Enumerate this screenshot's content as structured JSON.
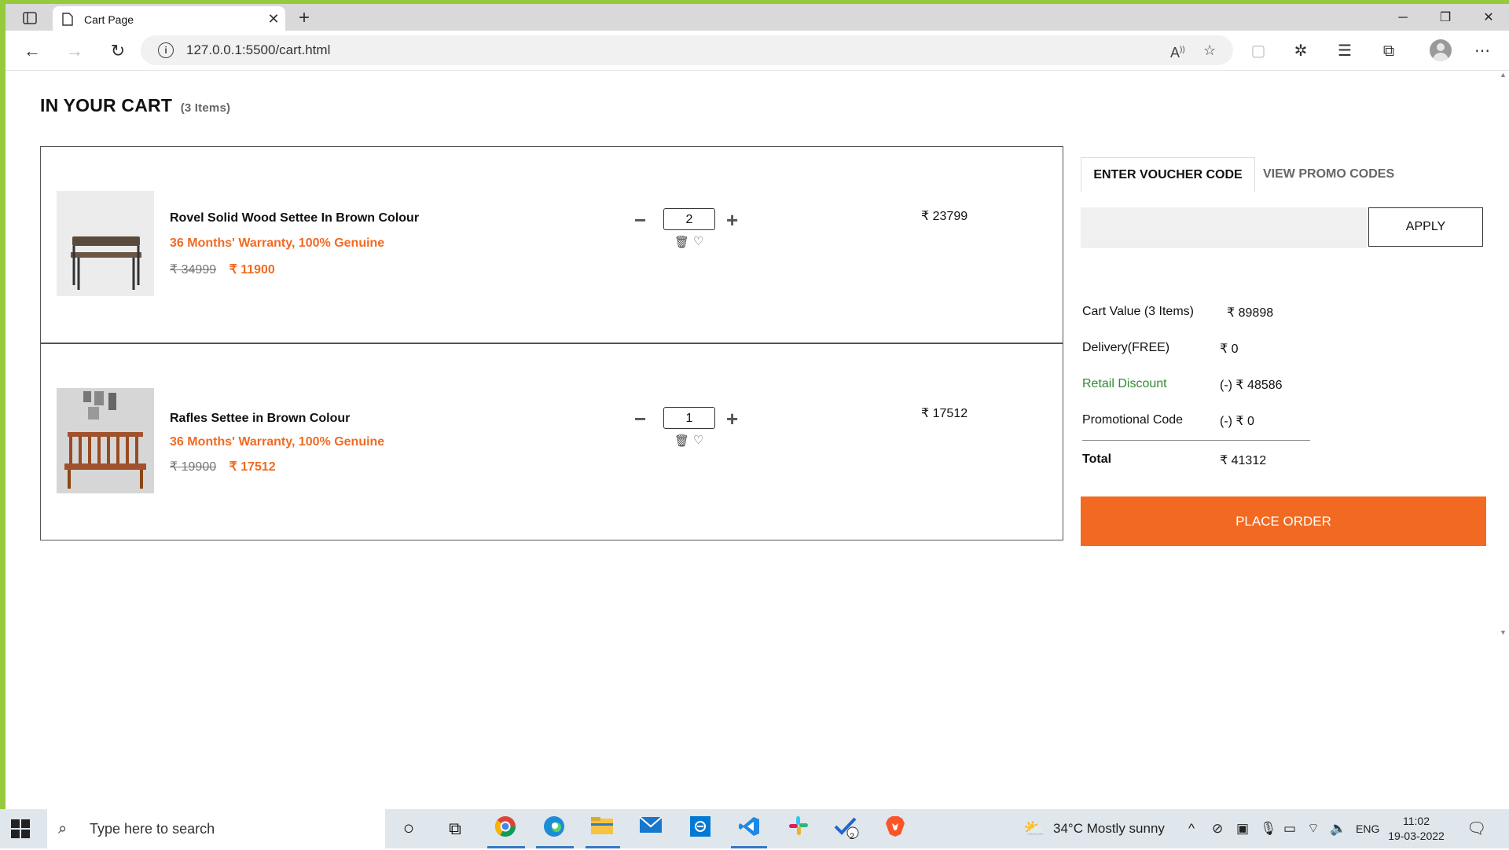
{
  "browser": {
    "tab_title": "Cart Page",
    "url": "127.0.0.1:5500/cart.html"
  },
  "page": {
    "heading": "IN YOUR CART",
    "item_count": "(3 Items)"
  },
  "cart_items": [
    {
      "name": "Rovel Solid Wood Settee In Brown Colour",
      "warranty": "36 Months' Warranty, 100% Genuine",
      "mrp": "₹ 34999",
      "price": "₹ 11900",
      "quantity": "2",
      "line_total": "₹ 23799"
    },
    {
      "name": "Rafles Settee in Brown Colour",
      "warranty": "36 Months' Warranty, 100% Genuine",
      "mrp": "₹ 19900",
      "price": "₹ 17512",
      "quantity": "1",
      "line_total": "₹ 17512"
    }
  ],
  "voucher": {
    "tab_active": "ENTER VOUCHER CODE",
    "tab_inactive": "VIEW PROMO CODES",
    "apply_label": "APPLY",
    "input_value": ""
  },
  "summary": {
    "cart_value_label": "Cart Value (3 Items)",
    "cart_value": "₹ 89898",
    "delivery_label": "Delivery(FREE)",
    "delivery_value": "₹ 0",
    "retail_discount_label": "Retail Discount",
    "retail_discount_value": "(-) ₹ 48586",
    "promo_label": "Promotional Code",
    "promo_value": "(-) ₹ 0",
    "total_label": "Total",
    "total_value": "₹ 41312",
    "place_order_label": "PLACE ORDER"
  },
  "taskbar": {
    "search_placeholder": "Type here to search",
    "weather": "34°C  Mostly sunny",
    "language": "ENG",
    "time": "11:02",
    "date": "19-03-2022",
    "todo_badge": "2"
  },
  "colors": {
    "accent": "#f26a22",
    "discount_green": "#2e8b2e",
    "frame_green": "#97c93c"
  }
}
